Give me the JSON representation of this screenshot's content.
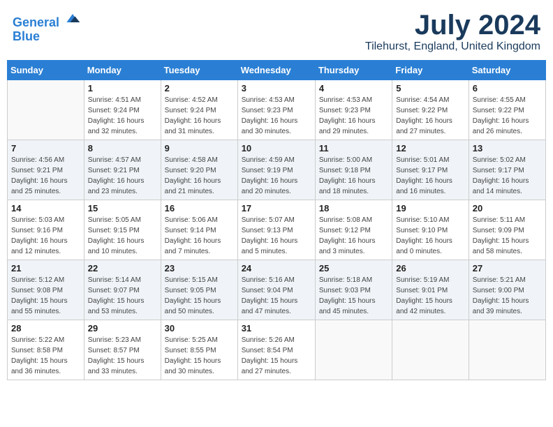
{
  "header": {
    "logo_line1": "General",
    "logo_line2": "Blue",
    "month_title": "July 2024",
    "location": "Tilehurst, England, United Kingdom"
  },
  "weekdays": [
    "Sunday",
    "Monday",
    "Tuesday",
    "Wednesday",
    "Thursday",
    "Friday",
    "Saturday"
  ],
  "weeks": [
    [
      {
        "day": "",
        "info": ""
      },
      {
        "day": "1",
        "info": "Sunrise: 4:51 AM\nSunset: 9:24 PM\nDaylight: 16 hours\nand 32 minutes."
      },
      {
        "day": "2",
        "info": "Sunrise: 4:52 AM\nSunset: 9:24 PM\nDaylight: 16 hours\nand 31 minutes."
      },
      {
        "day": "3",
        "info": "Sunrise: 4:53 AM\nSunset: 9:23 PM\nDaylight: 16 hours\nand 30 minutes."
      },
      {
        "day": "4",
        "info": "Sunrise: 4:53 AM\nSunset: 9:23 PM\nDaylight: 16 hours\nand 29 minutes."
      },
      {
        "day": "5",
        "info": "Sunrise: 4:54 AM\nSunset: 9:22 PM\nDaylight: 16 hours\nand 27 minutes."
      },
      {
        "day": "6",
        "info": "Sunrise: 4:55 AM\nSunset: 9:22 PM\nDaylight: 16 hours\nand 26 minutes."
      }
    ],
    [
      {
        "day": "7",
        "info": "Sunrise: 4:56 AM\nSunset: 9:21 PM\nDaylight: 16 hours\nand 25 minutes."
      },
      {
        "day": "8",
        "info": "Sunrise: 4:57 AM\nSunset: 9:21 PM\nDaylight: 16 hours\nand 23 minutes."
      },
      {
        "day": "9",
        "info": "Sunrise: 4:58 AM\nSunset: 9:20 PM\nDaylight: 16 hours\nand 21 minutes."
      },
      {
        "day": "10",
        "info": "Sunrise: 4:59 AM\nSunset: 9:19 PM\nDaylight: 16 hours\nand 20 minutes."
      },
      {
        "day": "11",
        "info": "Sunrise: 5:00 AM\nSunset: 9:18 PM\nDaylight: 16 hours\nand 18 minutes."
      },
      {
        "day": "12",
        "info": "Sunrise: 5:01 AM\nSunset: 9:17 PM\nDaylight: 16 hours\nand 16 minutes."
      },
      {
        "day": "13",
        "info": "Sunrise: 5:02 AM\nSunset: 9:17 PM\nDaylight: 16 hours\nand 14 minutes."
      }
    ],
    [
      {
        "day": "14",
        "info": "Sunrise: 5:03 AM\nSunset: 9:16 PM\nDaylight: 16 hours\nand 12 minutes."
      },
      {
        "day": "15",
        "info": "Sunrise: 5:05 AM\nSunset: 9:15 PM\nDaylight: 16 hours\nand 10 minutes."
      },
      {
        "day": "16",
        "info": "Sunrise: 5:06 AM\nSunset: 9:14 PM\nDaylight: 16 hours\nand 7 minutes."
      },
      {
        "day": "17",
        "info": "Sunrise: 5:07 AM\nSunset: 9:13 PM\nDaylight: 16 hours\nand 5 minutes."
      },
      {
        "day": "18",
        "info": "Sunrise: 5:08 AM\nSunset: 9:12 PM\nDaylight: 16 hours\nand 3 minutes."
      },
      {
        "day": "19",
        "info": "Sunrise: 5:10 AM\nSunset: 9:10 PM\nDaylight: 16 hours\nand 0 minutes."
      },
      {
        "day": "20",
        "info": "Sunrise: 5:11 AM\nSunset: 9:09 PM\nDaylight: 15 hours\nand 58 minutes."
      }
    ],
    [
      {
        "day": "21",
        "info": "Sunrise: 5:12 AM\nSunset: 9:08 PM\nDaylight: 15 hours\nand 55 minutes."
      },
      {
        "day": "22",
        "info": "Sunrise: 5:14 AM\nSunset: 9:07 PM\nDaylight: 15 hours\nand 53 minutes."
      },
      {
        "day": "23",
        "info": "Sunrise: 5:15 AM\nSunset: 9:05 PM\nDaylight: 15 hours\nand 50 minutes."
      },
      {
        "day": "24",
        "info": "Sunrise: 5:16 AM\nSunset: 9:04 PM\nDaylight: 15 hours\nand 47 minutes."
      },
      {
        "day": "25",
        "info": "Sunrise: 5:18 AM\nSunset: 9:03 PM\nDaylight: 15 hours\nand 45 minutes."
      },
      {
        "day": "26",
        "info": "Sunrise: 5:19 AM\nSunset: 9:01 PM\nDaylight: 15 hours\nand 42 minutes."
      },
      {
        "day": "27",
        "info": "Sunrise: 5:21 AM\nSunset: 9:00 PM\nDaylight: 15 hours\nand 39 minutes."
      }
    ],
    [
      {
        "day": "28",
        "info": "Sunrise: 5:22 AM\nSunset: 8:58 PM\nDaylight: 15 hours\nand 36 minutes."
      },
      {
        "day": "29",
        "info": "Sunrise: 5:23 AM\nSunset: 8:57 PM\nDaylight: 15 hours\nand 33 minutes."
      },
      {
        "day": "30",
        "info": "Sunrise: 5:25 AM\nSunset: 8:55 PM\nDaylight: 15 hours\nand 30 minutes."
      },
      {
        "day": "31",
        "info": "Sunrise: 5:26 AM\nSunset: 8:54 PM\nDaylight: 15 hours\nand 27 minutes."
      },
      {
        "day": "",
        "info": ""
      },
      {
        "day": "",
        "info": ""
      },
      {
        "day": "",
        "info": ""
      }
    ]
  ]
}
